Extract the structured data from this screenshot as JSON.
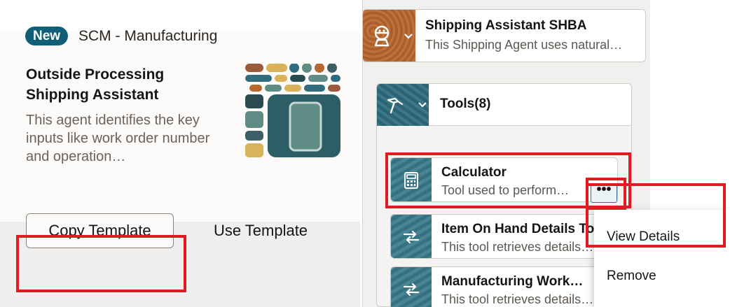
{
  "template_card": {
    "badge": "New",
    "category": "SCM - Manufacturing",
    "title": "Outside Processing Shipping Assistant",
    "description": "This agent identifies the key inputs like work order number and operation…",
    "copy_button": "Copy Template",
    "use_button": "Use Template",
    "illustration_icon": "stacked-blocks-illustration"
  },
  "agent": {
    "name": "Shipping Assistant SHBA",
    "description": "This Shipping Agent uses natural…",
    "icon": "robot-icon",
    "tile_color": "#b8672f"
  },
  "tools": {
    "header": "Tools(8)",
    "icon": "hammer-icon",
    "items": [
      {
        "name": "Calculator",
        "description": "Tool used to perform…",
        "icon": "calculator-icon"
      },
      {
        "name": "Item On Hand Details To",
        "description": "This tool retrieves details…",
        "icon": "transfer-arrows-icon"
      },
      {
        "name": "Manufacturing Work…",
        "description": "This tool retrieves details…",
        "icon": "transfer-arrows-icon"
      }
    ]
  },
  "more_actions": "•••",
  "context_menu": {
    "items": [
      "View Details",
      "Remove"
    ]
  },
  "colors": {
    "accent_teal": "#0f5f76",
    "highlight_red": "#e21b22"
  }
}
